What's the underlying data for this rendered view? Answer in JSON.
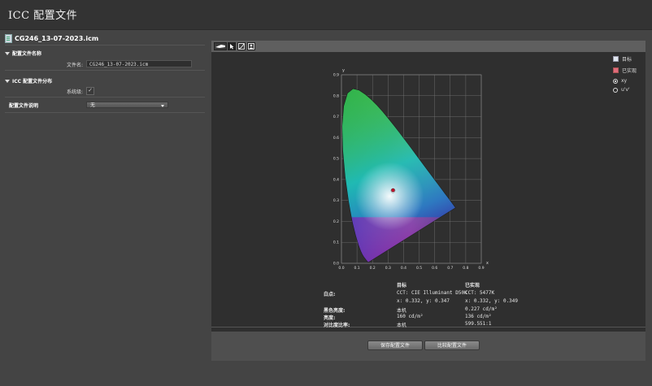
{
  "window": {
    "title": "ICC 配置文件"
  },
  "left": {
    "file_name": "CG246_13-07-2023.icm",
    "sections": {
      "profile_name": "配置文件名称",
      "profile_dist": "ICC 配置文件分布",
      "profile_desc": "配置文件说明"
    },
    "file_name_label": "文件名:",
    "file_name_value": "CG246_13-07-2023.icm",
    "system_label": "系统级:",
    "system_check": "✓",
    "desc_value": "无"
  },
  "toolbar": {
    "icons": [
      "sensor-icon",
      "pointer-icon",
      "curve-icon",
      "image-icon"
    ]
  },
  "legend": {
    "target": "目标",
    "achieved": "已实现",
    "xy": "xy",
    "uv": "u'v'",
    "target_color": "#dfe6ee",
    "achieved_color": "#e06b7b"
  },
  "chart_data": {
    "type": "scatter",
    "title": "",
    "xlabel": "x",
    "ylabel": "y",
    "xlim": [
      0,
      0.9
    ],
    "ylim": [
      0,
      0.9
    ],
    "xticks": [
      "0.0",
      "0.1",
      "0.2",
      "0.3",
      "0.4",
      "0.5",
      "0.6",
      "0.7",
      "0.8",
      "0.9"
    ],
    "yticks": [
      "0.0",
      "0.1",
      "0.2",
      "0.3",
      "0.4",
      "0.5",
      "0.6",
      "0.7",
      "0.8",
      "0.9"
    ],
    "grid": true,
    "series": [
      {
        "name": "目标",
        "points": [
          [
            0.332,
            0.347
          ]
        ]
      },
      {
        "name": "已实现",
        "points": [
          [
            0.332,
            0.349
          ]
        ]
      }
    ]
  },
  "info": {
    "col_target": "目标",
    "col_achieved": "已实现",
    "white_label": "白点:",
    "white_target_1": "CCT: CIE Illuminant D50K",
    "white_target_2": "x: 0.332, y: 0.347",
    "white_achieved_1": "CCT: 5477K",
    "white_achieved_2": "x: 0.332, y: 0.349",
    "black_label": "黑色亮度:",
    "black_target": "本机",
    "black_achieved": "0.227 cd/m²",
    "lum_label": "亮度:",
    "lum_target": "160 cd/m²",
    "lum_achieved": "136 cd/m²",
    "contrast_label": "对比度比率:",
    "contrast_target": "本机",
    "contrast_achieved": "599.551:1"
  },
  "buttons": {
    "save": "保存配置文件",
    "compare": "比较配置文件"
  }
}
